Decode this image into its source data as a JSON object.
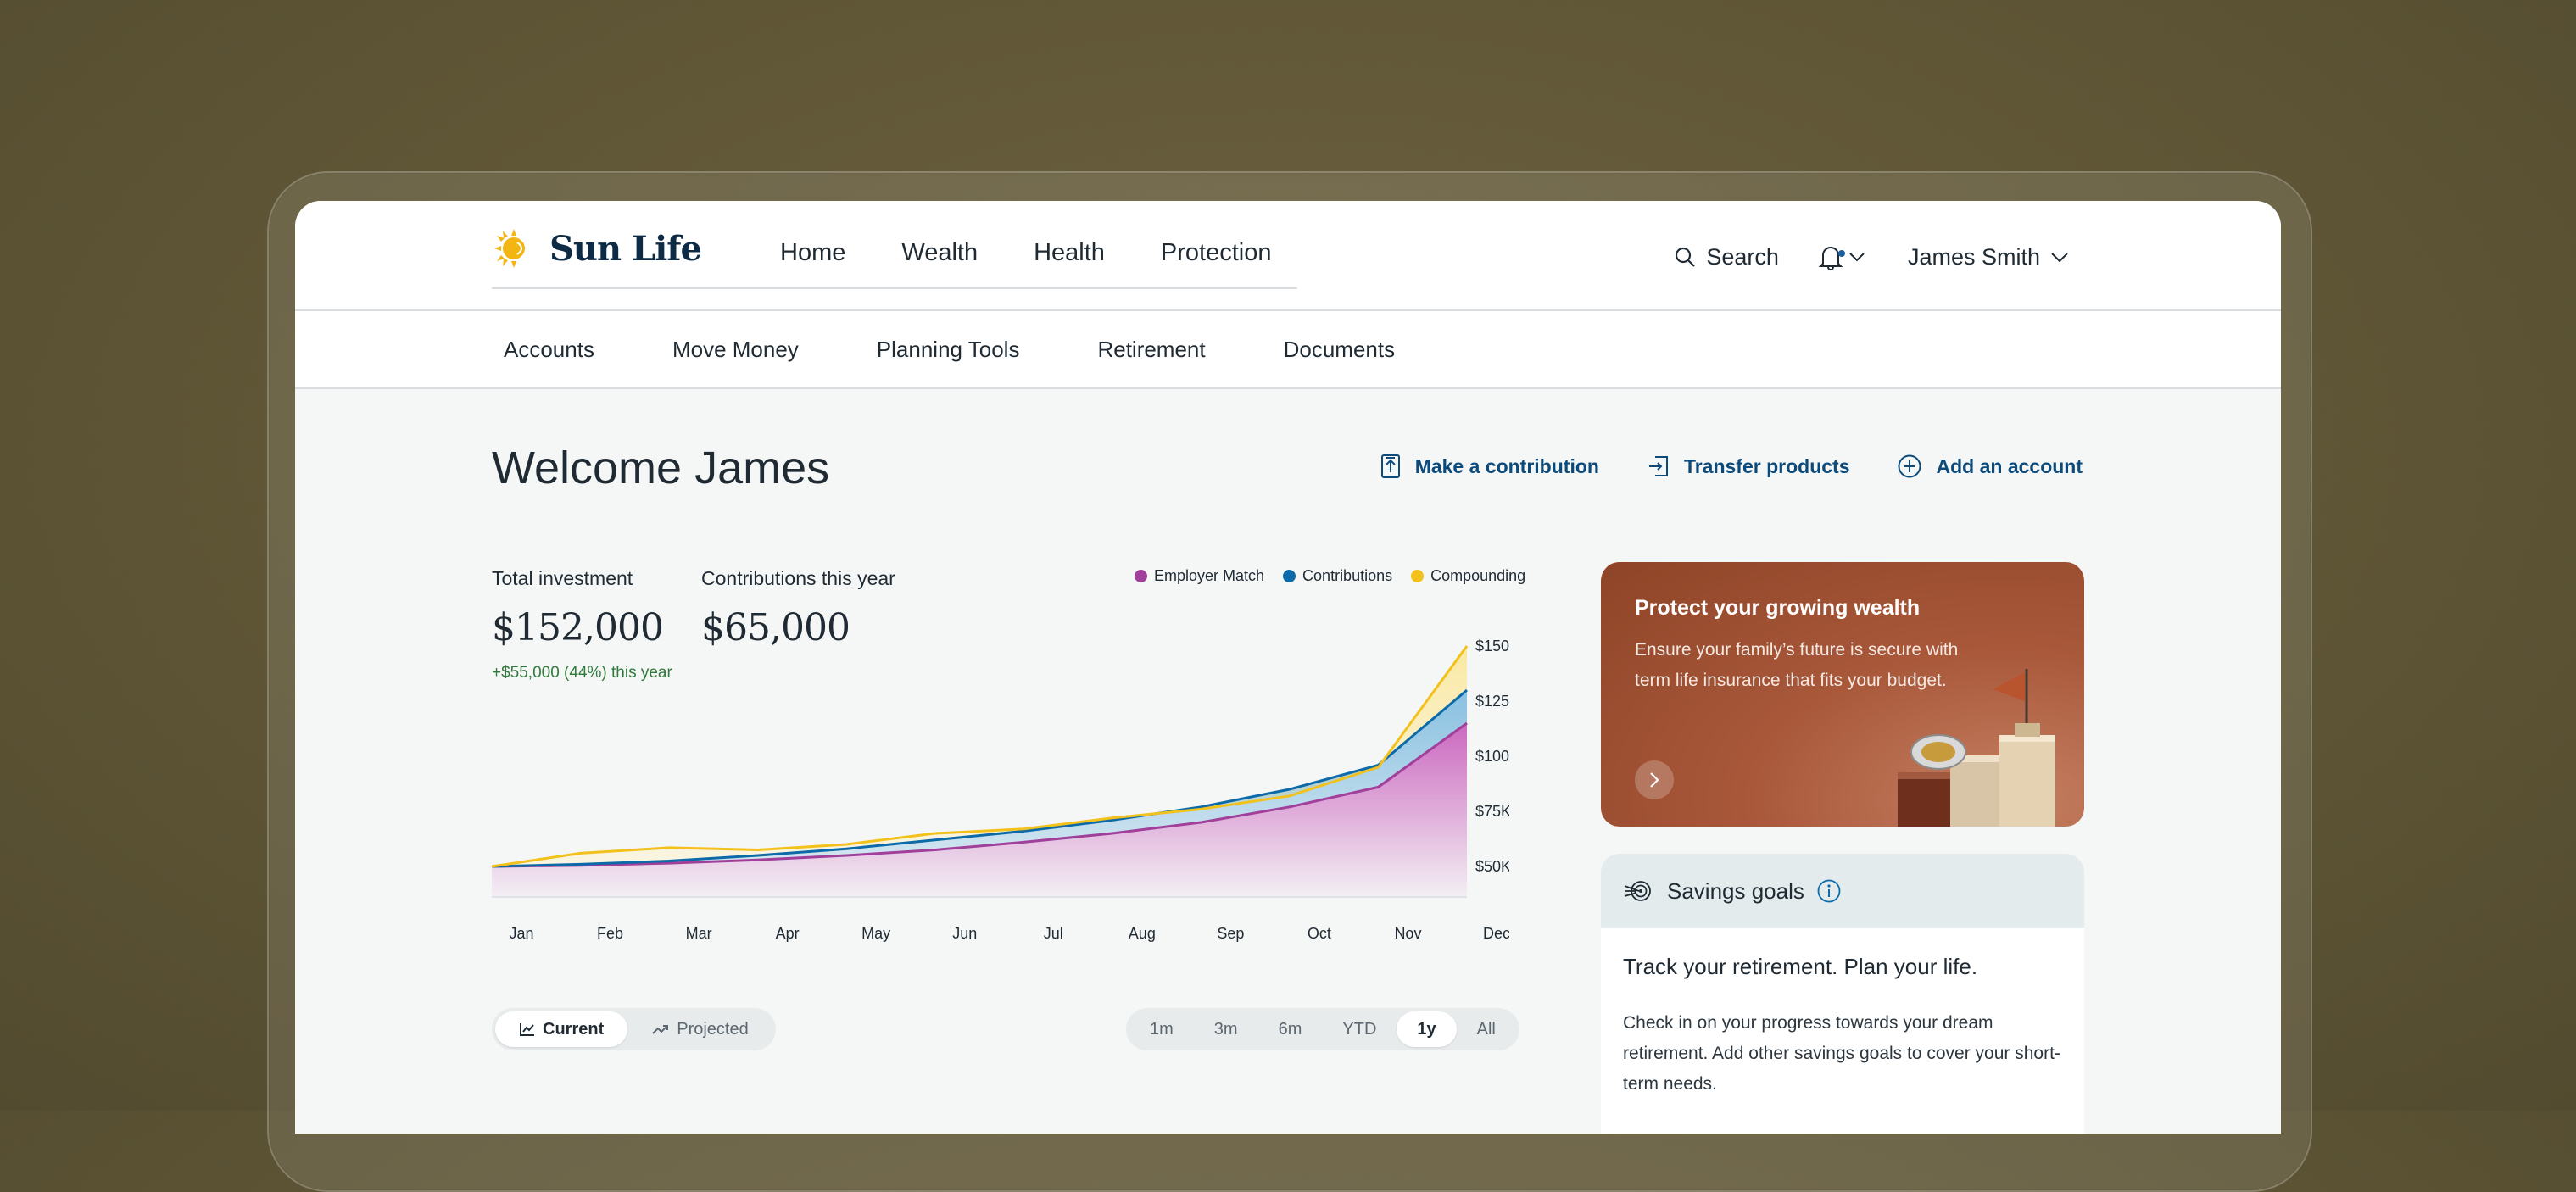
{
  "brand": {
    "name": "Sun Life",
    "logo_color": "#f2b512"
  },
  "main_nav": [
    {
      "label": "Home",
      "active": false
    },
    {
      "label": "Wealth",
      "active": true
    },
    {
      "label": "Health",
      "active": false
    },
    {
      "label": "Protection",
      "active": false
    }
  ],
  "header": {
    "search_label": "Search",
    "user_name": "James Smith",
    "has_notification": true
  },
  "sub_nav": [
    "Accounts",
    "Move Money",
    "Planning Tools",
    "Retirement",
    "Documents"
  ],
  "page": {
    "welcome": "Welcome James"
  },
  "actions": [
    {
      "label": "Make a contribution",
      "icon": "upload-icon"
    },
    {
      "label": "Transfer products",
      "icon": "transfer-icon"
    },
    {
      "label": "Add an account",
      "icon": "plus-circle-icon"
    }
  ],
  "stats": {
    "total_label": "Total investment",
    "total_value": "$152,000",
    "total_change": "+$55,000 (44%) this year",
    "contrib_label": "Contributions this year",
    "contrib_value": "$65,000"
  },
  "chart_data": {
    "type": "area",
    "x": [
      "Jan",
      "Feb",
      "Mar",
      "Apr",
      "May",
      "Jun",
      "Jul",
      "Aug",
      "Sep",
      "Oct",
      "Nov",
      "Dec"
    ],
    "y_ticks": [
      "$50K",
      "$75K",
      "$100K",
      "$125K",
      "$150K"
    ],
    "ylim": [
      50000,
      150000
    ],
    "legend_position": "top-right",
    "grid": false,
    "series": [
      {
        "name": "Employer Match",
        "color": "#a0409a",
        "values": [
          50000,
          50500,
          51500,
          53000,
          55000,
          57500,
          61000,
          65000,
          70000,
          77000,
          86000,
          115000
        ]
      },
      {
        "name": "Contributions",
        "color": "#0c6aa8",
        "values": [
          50000,
          51000,
          52500,
          55000,
          58000,
          62000,
          66000,
          71000,
          77000,
          85000,
          96000,
          130000
        ]
      },
      {
        "name": "Compounding",
        "color": "#f2c11c",
        "values": [
          50000,
          56000,
          58500,
          57500,
          60000,
          65000,
          67000,
          72000,
          76000,
          82000,
          95000,
          150000
        ]
      }
    ]
  },
  "toggles": {
    "view": [
      {
        "label": "Current",
        "icon": "line-chart-icon",
        "selected": true
      },
      {
        "label": "Projected",
        "icon": "trend-up-icon",
        "selected": false
      }
    ],
    "range": [
      {
        "label": "1m",
        "selected": false
      },
      {
        "label": "3m",
        "selected": false
      },
      {
        "label": "6m",
        "selected": false
      },
      {
        "label": "YTD",
        "selected": false
      },
      {
        "label": "1y",
        "selected": true
      },
      {
        "label": "All",
        "selected": false
      }
    ]
  },
  "promo": {
    "title": "Protect your growing wealth",
    "body": "Ensure your family’s future is secure with term life insurance that fits your budget."
  },
  "savings": {
    "title": "Savings goals",
    "heading": "Track your retirement. Plan your life.",
    "body": "Check in on your progress towards your dream retirement. Add other savings goals to cover your short-term needs."
  }
}
